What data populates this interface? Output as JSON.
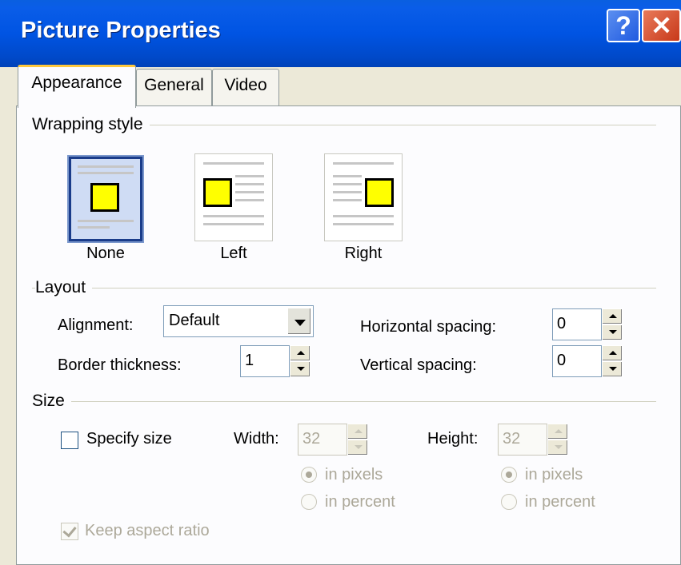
{
  "window": {
    "title": "Picture Properties",
    "help_label": "?",
    "close_label": "✕"
  },
  "tabs": [
    {
      "label": "Appearance",
      "active": true
    },
    {
      "label": "General",
      "active": false
    },
    {
      "label": "Video",
      "active": false
    }
  ],
  "wrapping": {
    "group_label": "Wrapping style",
    "options": [
      {
        "label": "None",
        "selected": true
      },
      {
        "label": "Left",
        "selected": false
      },
      {
        "label": "Right",
        "selected": false
      }
    ]
  },
  "layout": {
    "group_label": "Layout",
    "alignment_label": "Alignment:",
    "alignment_value": "Default",
    "border_label": "Border thickness:",
    "border_value": "1",
    "hspacing_label": "Horizontal spacing:",
    "hspacing_value": "0",
    "vspacing_label": "Vertical spacing:",
    "vspacing_value": "0"
  },
  "size": {
    "group_label": "Size",
    "specify_label": "Specify size",
    "specify_checked": false,
    "width_label": "Width:",
    "width_value": "32",
    "height_label": "Height:",
    "height_value": "32",
    "in_pixels": "in pixels",
    "in_percent": "in percent",
    "keep_aspect_label": "Keep aspect ratio",
    "keep_aspect_checked": true
  },
  "colors": {
    "titlebar": "#0054e3",
    "dialog_bg": "#ece9d8",
    "selected_border": "#1a3c8a",
    "square_fill": "#ffff00"
  }
}
